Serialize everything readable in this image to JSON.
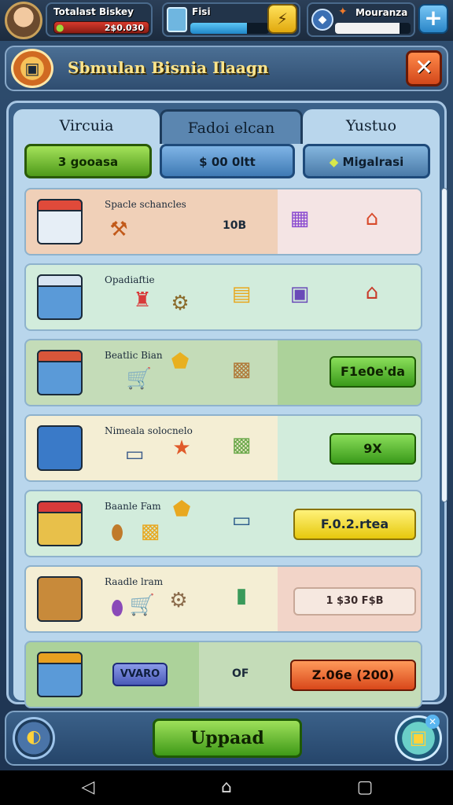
{
  "header": {
    "player_name": "Totalast Biskey",
    "money": "2$0.030",
    "energy_label": "Fisi",
    "energy_fill": 0.72,
    "gems_label": "Mouranza",
    "gems_fill": 0.85
  },
  "title": {
    "text": "Sbmulan Bisnia Ilaagn",
    "close_label": "✕"
  },
  "tabs": [
    {
      "label": "Vircuia"
    },
    {
      "label": "Fadoi elcan"
    },
    {
      "label": "Yustuo"
    }
  ],
  "subtabs": [
    {
      "label": "3 gooasa"
    },
    {
      "label": "$ 00 0ltt"
    },
    {
      "label": "Migalrasi"
    }
  ],
  "rows": [
    {
      "name": "Spacle schancles",
      "value": "10B",
      "button": ""
    },
    {
      "name": "Opadiaftie",
      "value": "",
      "button": ""
    },
    {
      "name": "Beatlic Bian",
      "value": "",
      "button": "F1e0e'da"
    },
    {
      "name": "Nimeala solocnelo",
      "value": "",
      "button": "9X"
    },
    {
      "name": "Baanle Fam",
      "value": "",
      "button": "F.0.2.rtea"
    },
    {
      "name": "Raadle lram",
      "value": "",
      "button": "1 $30 F$B"
    },
    {
      "name": "",
      "value": "OF",
      "badge": "VVARO",
      "button": "Z.06e (200)"
    }
  ],
  "footer": {
    "upgrade_label": "Uppaad"
  },
  "colors": {
    "green_button": "#4e9a1a",
    "yellow_button": "#f0d028",
    "orange_button": "#d85a26",
    "panel_blue": "#3b6189"
  }
}
